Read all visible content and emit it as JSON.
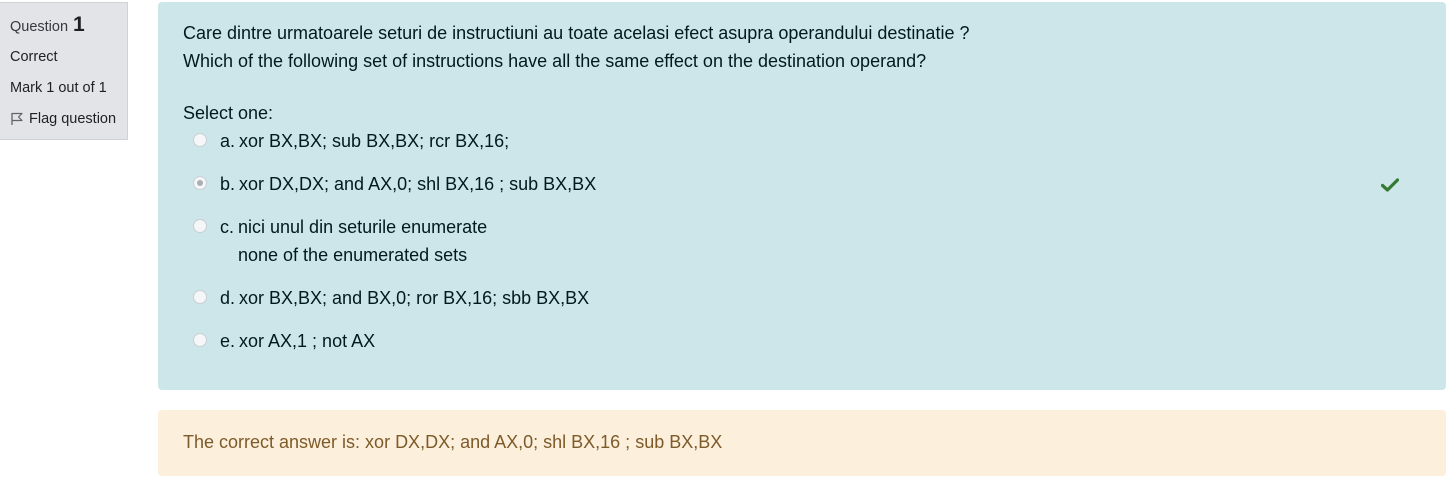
{
  "info": {
    "question_label": "Question",
    "question_number": "1",
    "state": "Correct",
    "grade": "Mark 1 out of 1",
    "flag_label": "Flag question",
    "flag_icon": "flag-icon"
  },
  "question": {
    "text_ro": "Care dintre urmatoarele seturi de instructiuni au toate acelasi efect asupra operandului destinatie ?",
    "text_en": "Which of the following set of instructions have all the same effect on the destination operand?",
    "prompt": "Select one:",
    "answers": [
      {
        "letter": "a.",
        "text": "xor BX,BX; sub BX,BX; rcr BX,16;",
        "selected": false
      },
      {
        "letter": "b.",
        "text": "xor DX,DX; and AX,0; shl BX,16 ; sub BX,BX",
        "selected": true,
        "status_icon": "check-icon"
      },
      {
        "letter": "c.",
        "text": "nici unul din seturile enumerate",
        "text2": "none of the enumerated sets",
        "selected": false
      },
      {
        "letter": "d.",
        "text": "xor BX,BX; and BX,0; ror BX,16; sbb BX,BX",
        "selected": false
      },
      {
        "letter": "e.",
        "text": "xor AX,1 ; not AX",
        "selected": false
      }
    ]
  },
  "feedback": {
    "text": "The correct answer is: xor DX,DX; and AX,0; shl BX,16 ; sub BX,BX"
  },
  "colors": {
    "formulation_bg": "#cce6ea",
    "feedback_bg": "#fcefdc",
    "info_bg": "#e2e4e7",
    "correct": "#357a32"
  }
}
